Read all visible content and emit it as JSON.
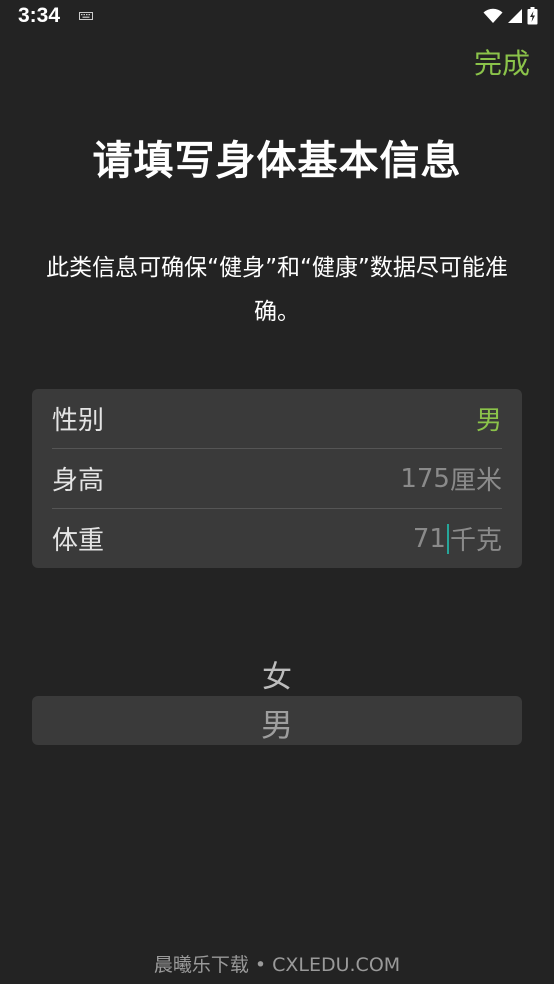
{
  "status_bar": {
    "time": "3:34",
    "icons": [
      "keyboard-icon",
      "wifi-icon",
      "signal-icon",
      "battery-icon"
    ]
  },
  "header": {
    "done_label": "完成"
  },
  "title": "请填写身体基本信息",
  "description": "此类信息可确保“健身”和“健康”数据尽可能准确。",
  "info": {
    "gender": {
      "label": "性别",
      "value": "男"
    },
    "height": {
      "label": "身高",
      "value": "175",
      "unit": "厘米"
    },
    "weight": {
      "label": "体重",
      "value": "71",
      "unit": "千克"
    }
  },
  "picker": {
    "options": [
      "女",
      "男"
    ],
    "selected": "男"
  },
  "watermark": "晨曦乐下载 • CXLEDU.COM",
  "colors": {
    "background": "#232323",
    "accent": "#8bc34a",
    "card": "#3a3a3a",
    "cursor": "#26a69a"
  }
}
